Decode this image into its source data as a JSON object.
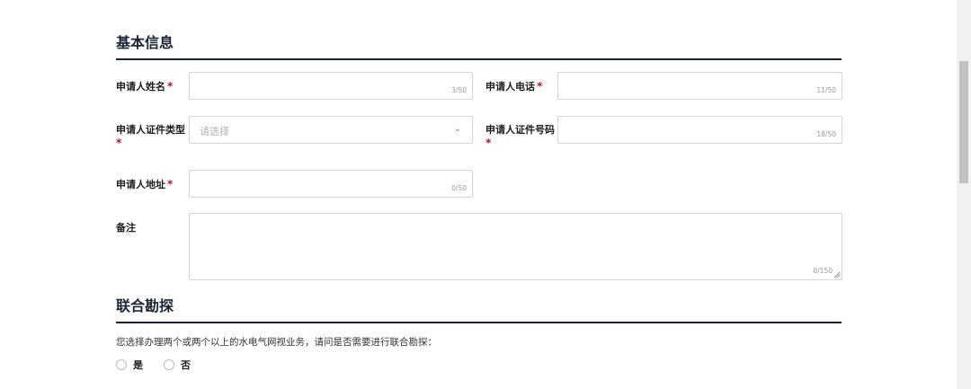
{
  "basic_info": {
    "title": "基本信息",
    "required_mark": "*",
    "applicant_name": {
      "label": "申请人姓名",
      "counter": "3/50"
    },
    "applicant_phone": {
      "label": "申请人电话",
      "counter": "11/50"
    },
    "id_type": {
      "label": "申请人证件类型",
      "placeholder": "请选择",
      "chevron": "⌄"
    },
    "id_number": {
      "label": "申请人证件号码",
      "counter": "18/50"
    },
    "address": {
      "label": "申请人地址",
      "counter": "0/50"
    },
    "remarks": {
      "label": "备注",
      "counter": "0/150"
    }
  },
  "joint_survey": {
    "title": "联合勘探",
    "question": "您选择办理两个或两个以上的水电气网视业务，请问是否需要进行联合勘探：",
    "options": [
      {
        "label": "是",
        "selected": false
      },
      {
        "label": "否",
        "selected": false
      }
    ]
  }
}
